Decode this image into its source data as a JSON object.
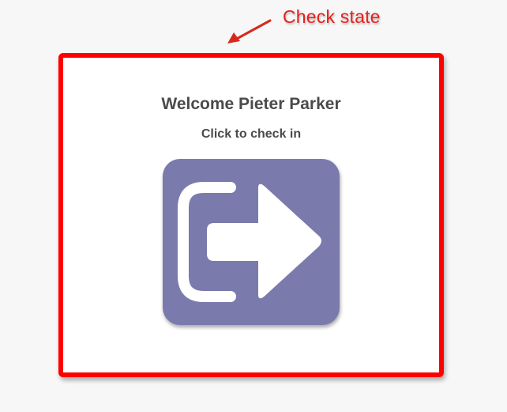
{
  "annotation": {
    "label": "Check state",
    "color": "#e8201a"
  },
  "card": {
    "border_color": "#ff0000",
    "welcome_text": "Welcome Pieter Parker",
    "subtitle": "Click to check in"
  },
  "checkin_button": {
    "icon": "sign-in-icon",
    "background_color": "#7b7aad"
  }
}
